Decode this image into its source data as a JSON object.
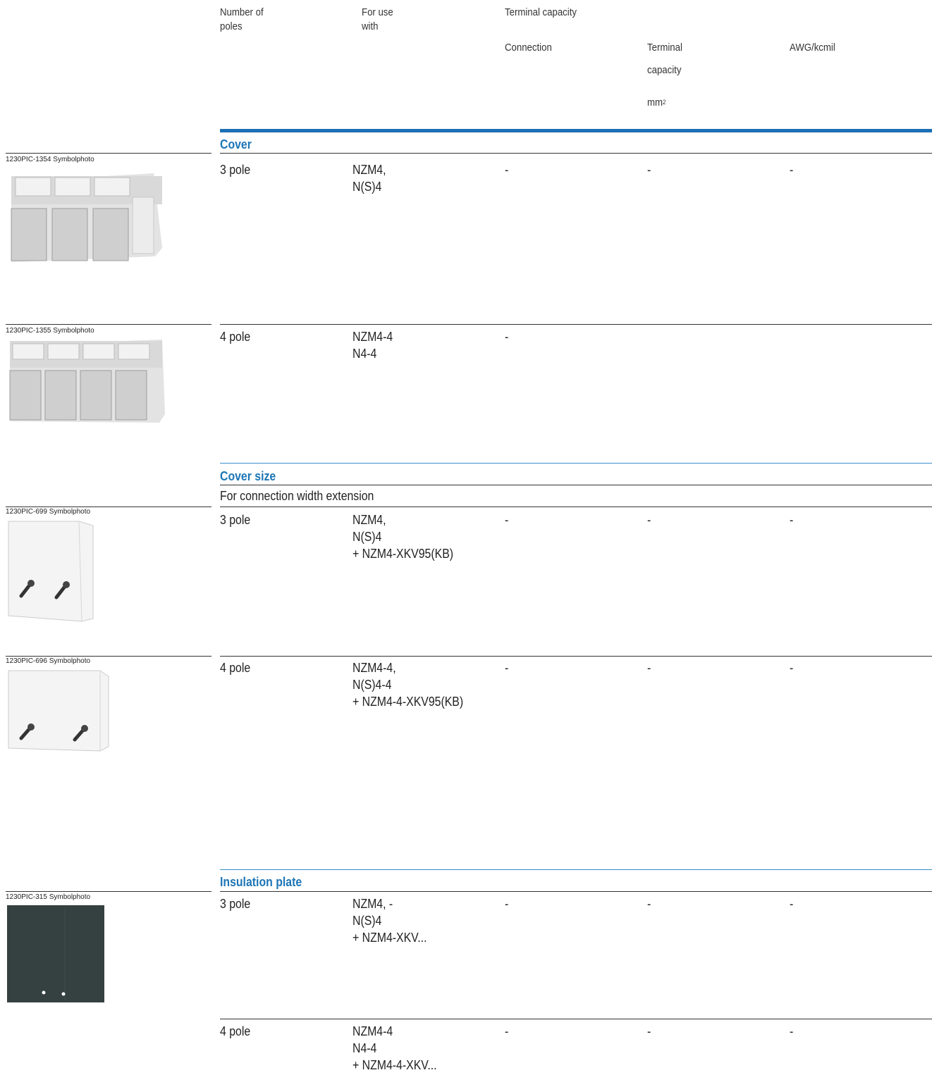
{
  "header": {
    "col_poles": "Number of\npoles",
    "col_use": "For use\nwith",
    "col_terminal": "Terminal capacity",
    "col_connection": "Connection",
    "col_terminal_capacity_1": "Terminal",
    "col_terminal_capacity_2": "capacity",
    "col_mm_unit": "mm",
    "col_mm_sup": "2",
    "col_awg": "AWG/kcmil"
  },
  "sections": {
    "cover": "Cover",
    "cover_size": "Cover size",
    "cover_size_sub": "For connection width extension",
    "insulation": "Insulation plate"
  },
  "rows": [
    {
      "caption": "1230PIC-1354 Symbolphoto",
      "poles": "3 pole",
      "use": "NZM4,\nN(S)4",
      "connection": "-",
      "capacity": "-",
      "awg": "-"
    },
    {
      "caption": "1230PIC-1355 Symbolphoto",
      "poles": "4 pole",
      "use": "NZM4-4\nN4-4",
      "connection": "-",
      "capacity": "",
      "awg": ""
    },
    {
      "caption": "1230PIC-699 Symbolphoto",
      "poles": "3 pole",
      "use": "NZM4,\nN(S)4\n+ NZM4-XKV95(KB)",
      "connection": "-",
      "capacity": "-",
      "awg": "-"
    },
    {
      "caption": "1230PIC-696 Symbolphoto",
      "poles": "4 pole",
      "use": "NZM4-4,\nN(S)4-4\n+ NZM4-4-XKV95(KB)",
      "connection": "-",
      "capacity": "-",
      "awg": "-"
    },
    {
      "caption": "1230PIC-315 Symbolphoto",
      "poles": "3 pole",
      "use": "NZM4, -\nN(S)4\n+ NZM4-XKV...",
      "connection": "-",
      "capacity": "-",
      "awg": "-"
    },
    {
      "caption": "",
      "poles": "4 pole",
      "use": "NZM4-4\nN4-4\n+ NZM4-4-XKV...",
      "connection": "-",
      "capacity": "-",
      "awg": "-"
    }
  ],
  "colors": {
    "accent": "#1d76b6",
    "rule": "#333333"
  }
}
